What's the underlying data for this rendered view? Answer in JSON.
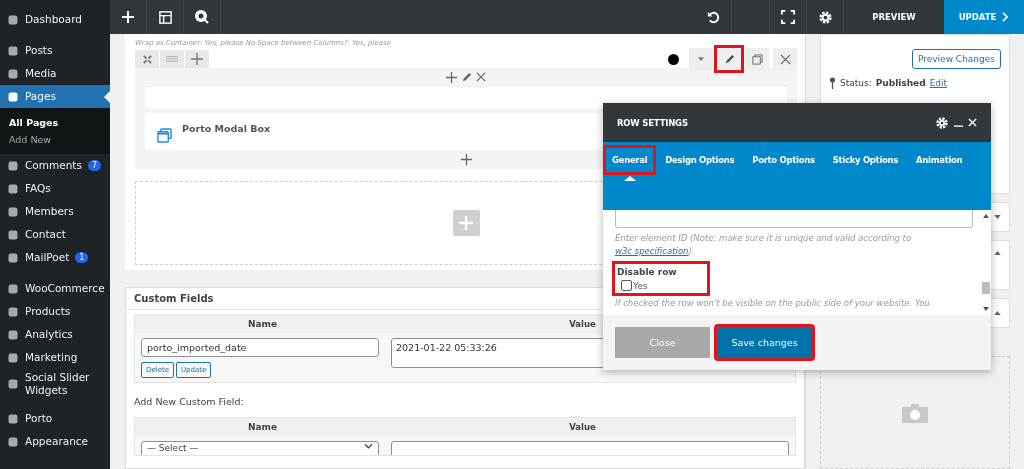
{
  "sidebar": {
    "groups": [
      [
        {
          "label": "Dashboard",
          "selected": false
        }
      ],
      [
        {
          "label": "Posts",
          "selected": false
        },
        {
          "label": "Media",
          "selected": false
        },
        {
          "label": "Pages",
          "selected": true,
          "children": [
            {
              "label": "All Pages",
              "selected": true
            },
            {
              "label": "Add New",
              "selected": false
            }
          ]
        },
        {
          "label": "Comments",
          "selected": false,
          "badge": "7"
        },
        {
          "label": "FAQs",
          "selected": false
        },
        {
          "label": "Members",
          "selected": false
        },
        {
          "label": "Contact",
          "selected": false
        },
        {
          "label": "MailPoet",
          "selected": false,
          "badge": "1"
        }
      ],
      [
        {
          "label": "WooCommerce",
          "selected": false
        },
        {
          "label": "Products",
          "selected": false
        },
        {
          "label": "Analytics",
          "selected": false
        },
        {
          "label": "Marketing",
          "selected": false
        },
        {
          "label": "Social Slider Widgets",
          "selected": false
        }
      ],
      [
        {
          "label": "Porto",
          "selected": false
        },
        {
          "label": "Appearance",
          "selected": false
        }
      ]
    ]
  },
  "toolbar": {
    "preview": "PREVIEW",
    "update": "UPDATE"
  },
  "builder": {
    "row_info": "Wrap as Container: Yes, please  No Space between Columns?: Yes, please",
    "edit_highlighted": true,
    "element": "Porto Modal Box"
  },
  "custom_fields": {
    "title": "Custom Fields",
    "columns": [
      "Name",
      "Value"
    ],
    "rows": [
      {
        "name": "porto_imported_date",
        "value": "2021-01-22 05:33:26",
        "buttons": [
          "Delete",
          "Update"
        ]
      }
    ],
    "add_title": "Add New Custom Field:",
    "add_columns": [
      "Name",
      "Value"
    ],
    "select": "— Select —"
  },
  "publish": {
    "preview_button": "Preview Changes",
    "status_label": "Status:",
    "status_value": "Published",
    "edit_link": "Edit"
  },
  "modal": {
    "title": "ROW SETTINGS",
    "tabs": [
      {
        "label": "General",
        "selected": true,
        "highlighted": true
      },
      {
        "label": "Design Options",
        "selected": false,
        "highlighted": false
      },
      {
        "label": "Porto Options",
        "selected": false,
        "highlighted": false
      },
      {
        "label": "Sticky Options",
        "selected": false,
        "highlighted": false
      },
      {
        "label": "Animation",
        "selected": false,
        "highlighted": false
      }
    ],
    "id_help": "Enter element ID (Note: make sure it is unique and valid according to",
    "id_help_link": "w3c specification",
    "id_help_end": ").",
    "disable": {
      "label": "Disable row",
      "option": "Yes",
      "checked": false,
      "highlighted": true
    },
    "disable_help": "If checked the row won't be visible on the public side of your website. You",
    "buttons": [
      {
        "label": "Close",
        "kind": "secondary",
        "highlighted": false
      },
      {
        "label": "Save changes",
        "kind": "primary",
        "highlighted": true
      }
    ]
  }
}
